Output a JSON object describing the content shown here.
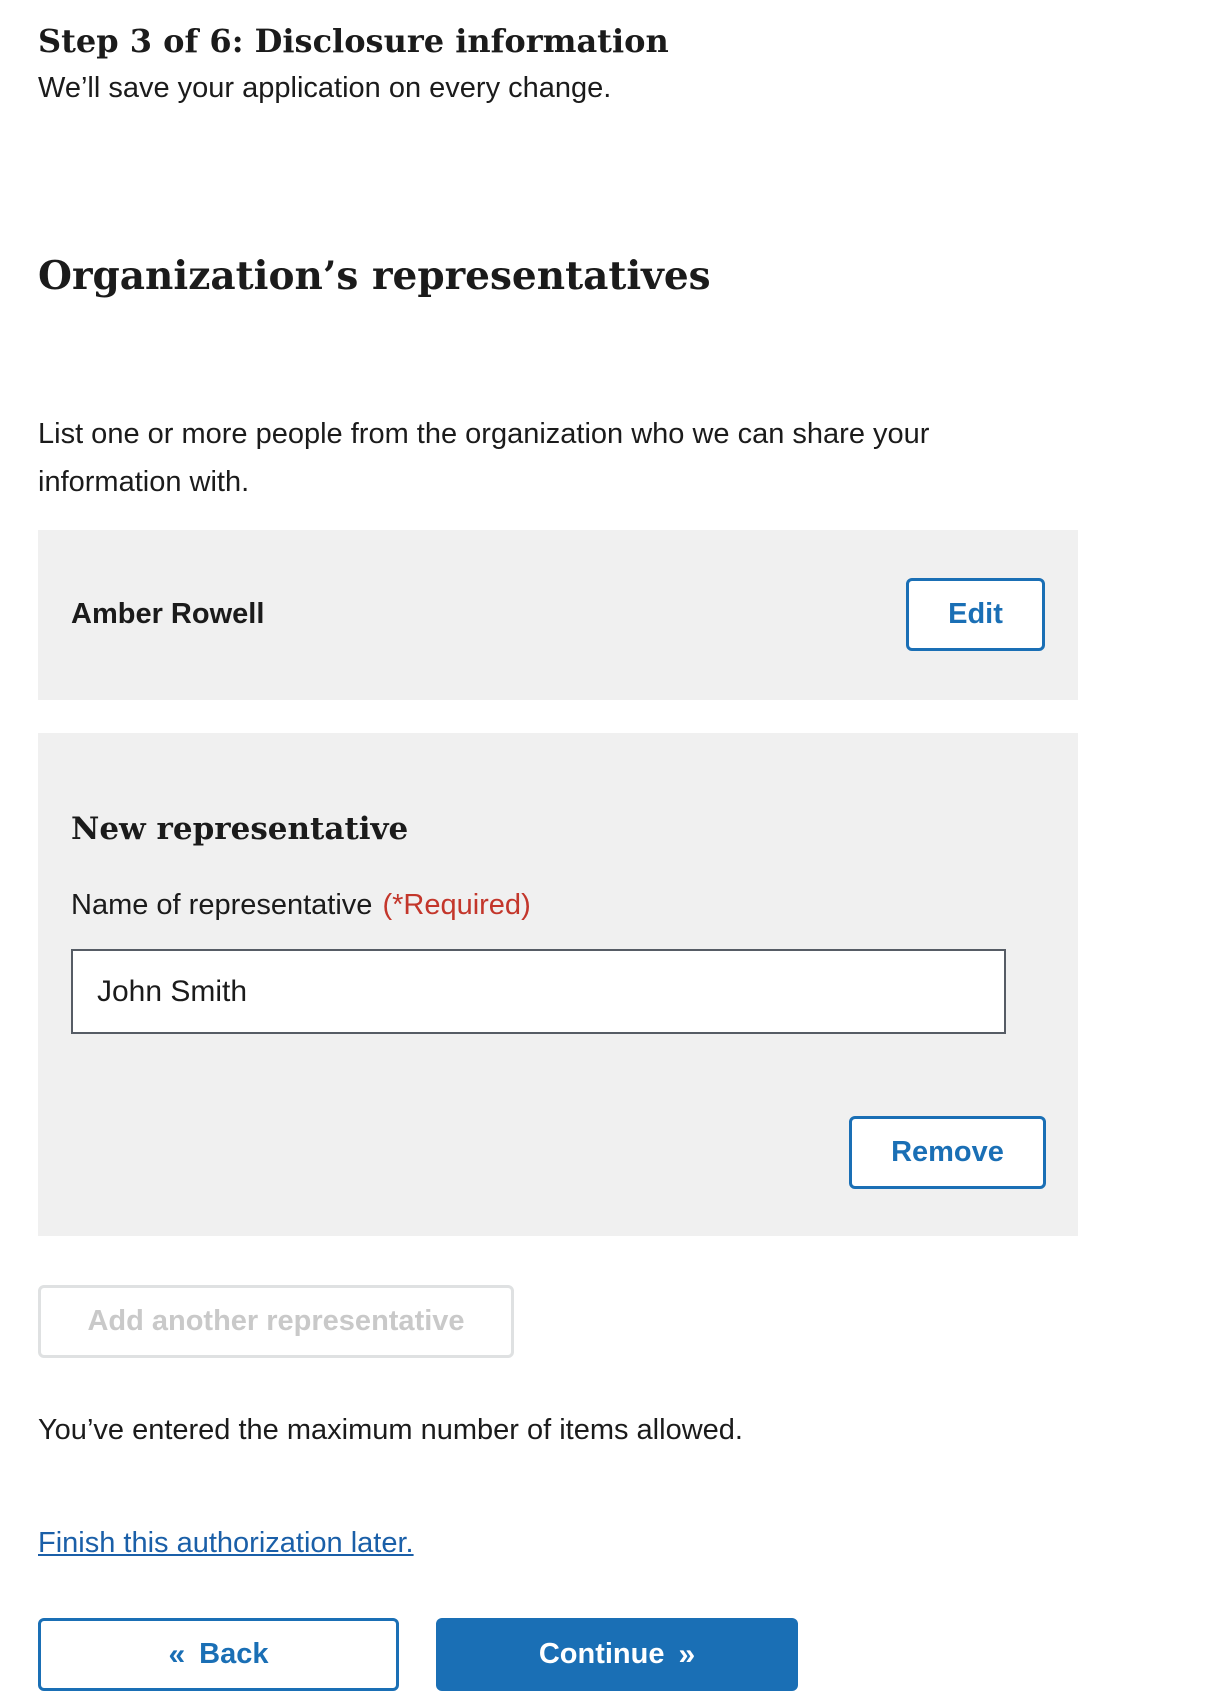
{
  "header": {
    "step_title": "Step 3 of 6: Disclosure information",
    "subtitle": "We’ll save your application on every change."
  },
  "section": {
    "heading": "Organization’s representatives",
    "intro": "List one or more people from the organization who we can share your information with."
  },
  "existing_representative": {
    "name": "Amber Rowell",
    "edit_label": "Edit"
  },
  "new_representative": {
    "heading": "New representative",
    "field_label": "Name of representative",
    "required_label": "(*Required)",
    "field_value": "John Smith",
    "remove_label": "Remove"
  },
  "add_another": {
    "label": "Add another representative",
    "disabled": true
  },
  "max_note": "You’ve entered the maximum number of items allowed.",
  "finish_later_link": "Finish this authorization later.",
  "navigation": {
    "back_label": "Back",
    "back_icon": "«",
    "continue_label": "Continue",
    "continue_icon": "»"
  },
  "colors": {
    "primary": "#1a6fb5",
    "required": "#c3362b",
    "card_background": "#f0f0f0",
    "disabled_text": "#c9c9c9"
  }
}
